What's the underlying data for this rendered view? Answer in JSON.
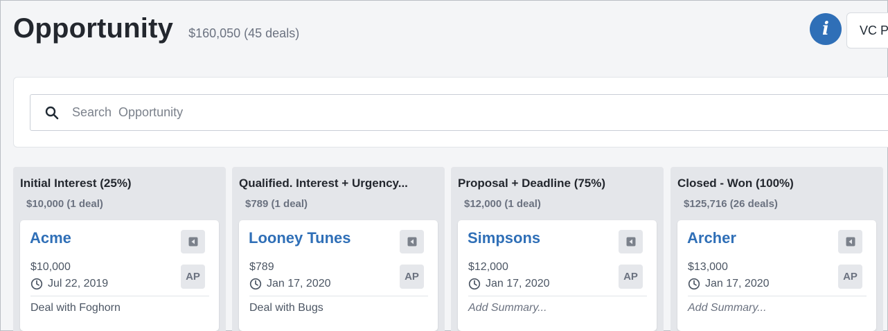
{
  "header": {
    "title": "Opportunity",
    "summary": "$160,050 (45 deals)",
    "info_icon": "i",
    "user_button": "VC P"
  },
  "search": {
    "placeholder": "Search  Opportunity",
    "value": ""
  },
  "columns": [
    {
      "title": "Initial Interest (25%)",
      "total": "$10,000 (1 deal)",
      "cards": [
        {
          "name": "Acme",
          "amount": "$10,000",
          "date": "Jul 22, 2019",
          "owner": "AP",
          "summary": "Deal with Foghorn",
          "summary_is_placeholder": false
        }
      ]
    },
    {
      "title": "Qualified. Interest + Urgency...",
      "total": "$789 (1 deal)",
      "cards": [
        {
          "name": "Looney Tunes",
          "amount": "$789",
          "date": "Jan 17, 2020",
          "owner": "AP",
          "summary": "Deal with Bugs",
          "summary_is_placeholder": false
        }
      ]
    },
    {
      "title": "Proposal + Deadline (75%)",
      "total": "$12,000 (1 deal)",
      "cards": [
        {
          "name": "Simpsons",
          "amount": "$12,000",
          "date": "Jan 17, 2020",
          "owner": "AP",
          "summary": "Add Summary...",
          "summary_is_placeholder": true
        }
      ]
    },
    {
      "title": "Closed - Won (100%)",
      "total": "$125,716 (26 deals)",
      "cards": [
        {
          "name": "Archer",
          "amount": "$13,000",
          "date": "Jan 17, 2020",
          "owner": "AP",
          "summary": "Add Summary...",
          "summary_is_placeholder": true
        }
      ]
    }
  ],
  "colors": {
    "accent": "#2f6fb7",
    "background": "#f4f5f7",
    "column_bg": "#e4e6ea",
    "muted_text": "#6b7280"
  },
  "icons": {
    "search": "search-icon",
    "info": "info-icon",
    "collapse": "collapse-left-icon",
    "clock": "clock-icon"
  }
}
